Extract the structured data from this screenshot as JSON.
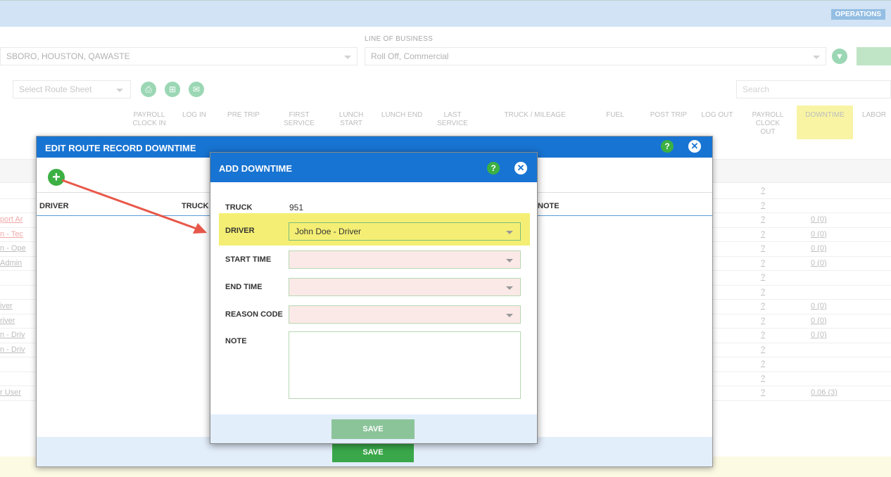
{
  "header": {
    "operations": "OPERATIONS"
  },
  "filters": {
    "location_value": "SBORO, HOUSTON, QAWASTE",
    "line_of_business_label": "LINE OF BUSINESS",
    "line_of_business_value": "Roll Off, Commercial",
    "route_sheet_placeholder": "Select Route Sheet",
    "search_placeholder": "Search"
  },
  "columns": [
    {
      "label": "PAYROLL CLOCK IN"
    },
    {
      "label": "LOG IN"
    },
    {
      "label": "PRE TRIP"
    },
    {
      "label": "FIRST SERVICE"
    },
    {
      "label": "LUNCH START"
    },
    {
      "label": "LUNCH END"
    },
    {
      "label": "LAST SERVICE"
    },
    {
      "label": "TRUCK / MILEAGE"
    },
    {
      "label": "FUEL"
    },
    {
      "label": "POST TRIP"
    },
    {
      "label": "LOG OUT"
    },
    {
      "label": "PAYROLL CLOCK OUT"
    },
    {
      "label": "DOWNTIME"
    },
    {
      "label": "LABOR"
    }
  ],
  "rows": [
    {
      "name": "",
      "q": "?",
      "downtime": ""
    },
    {
      "name": "",
      "q": "?",
      "downtime": ""
    },
    {
      "name": "port Ar",
      "q": "?",
      "downtime": "0 (0)"
    },
    {
      "name": "n - Tec",
      "q": "?",
      "downtime": "0 (0)"
    },
    {
      "name": "n - Ope",
      "q": "?",
      "downtime": "0 (0)"
    },
    {
      "name": "Admin",
      "q": "?",
      "downtime": "0 (0)"
    },
    {
      "name": "",
      "q": "?",
      "downtime": ""
    },
    {
      "name": "",
      "q": "?",
      "downtime": ""
    },
    {
      "name": "iver",
      "q": "?",
      "downtime": "0 (0)"
    },
    {
      "name": "river",
      "q": "?",
      "downtime": "0 (0)"
    },
    {
      "name": "n - Driv",
      "q": "?",
      "downtime": "0 (0)"
    },
    {
      "name": "n - Driv",
      "q": "?",
      "downtime": ""
    },
    {
      "name": "",
      "q": "?",
      "downtime": ""
    },
    {
      "name": "",
      "q": "?",
      "downtime": ""
    },
    {
      "name": "r User",
      "q": "?",
      "downtime": "0.06 (3)"
    }
  ],
  "edit_modal": {
    "title": "EDIT ROUTE RECORD DOWNTIME",
    "help": "?",
    "close": "✕",
    "col_driver": "DRIVER",
    "col_truck": "TRUCK",
    "col_note": "NOTE",
    "save_label": "SAVE"
  },
  "add_modal": {
    "title": "ADD DOWNTIME",
    "help": "?",
    "close": "✕",
    "truck_label": "TRUCK",
    "truck_value": "951",
    "driver_label": "DRIVER",
    "driver_value": "John Doe - Driver",
    "start_label": "START TIME",
    "end_label": "END TIME",
    "reason_label": "REASON CODE",
    "note_label": "NOTE",
    "save_label": "SAVE"
  },
  "colors": {
    "header_blue": "#1874d2",
    "save_green": "#3aa84a",
    "highlight": "#f4ef74"
  }
}
